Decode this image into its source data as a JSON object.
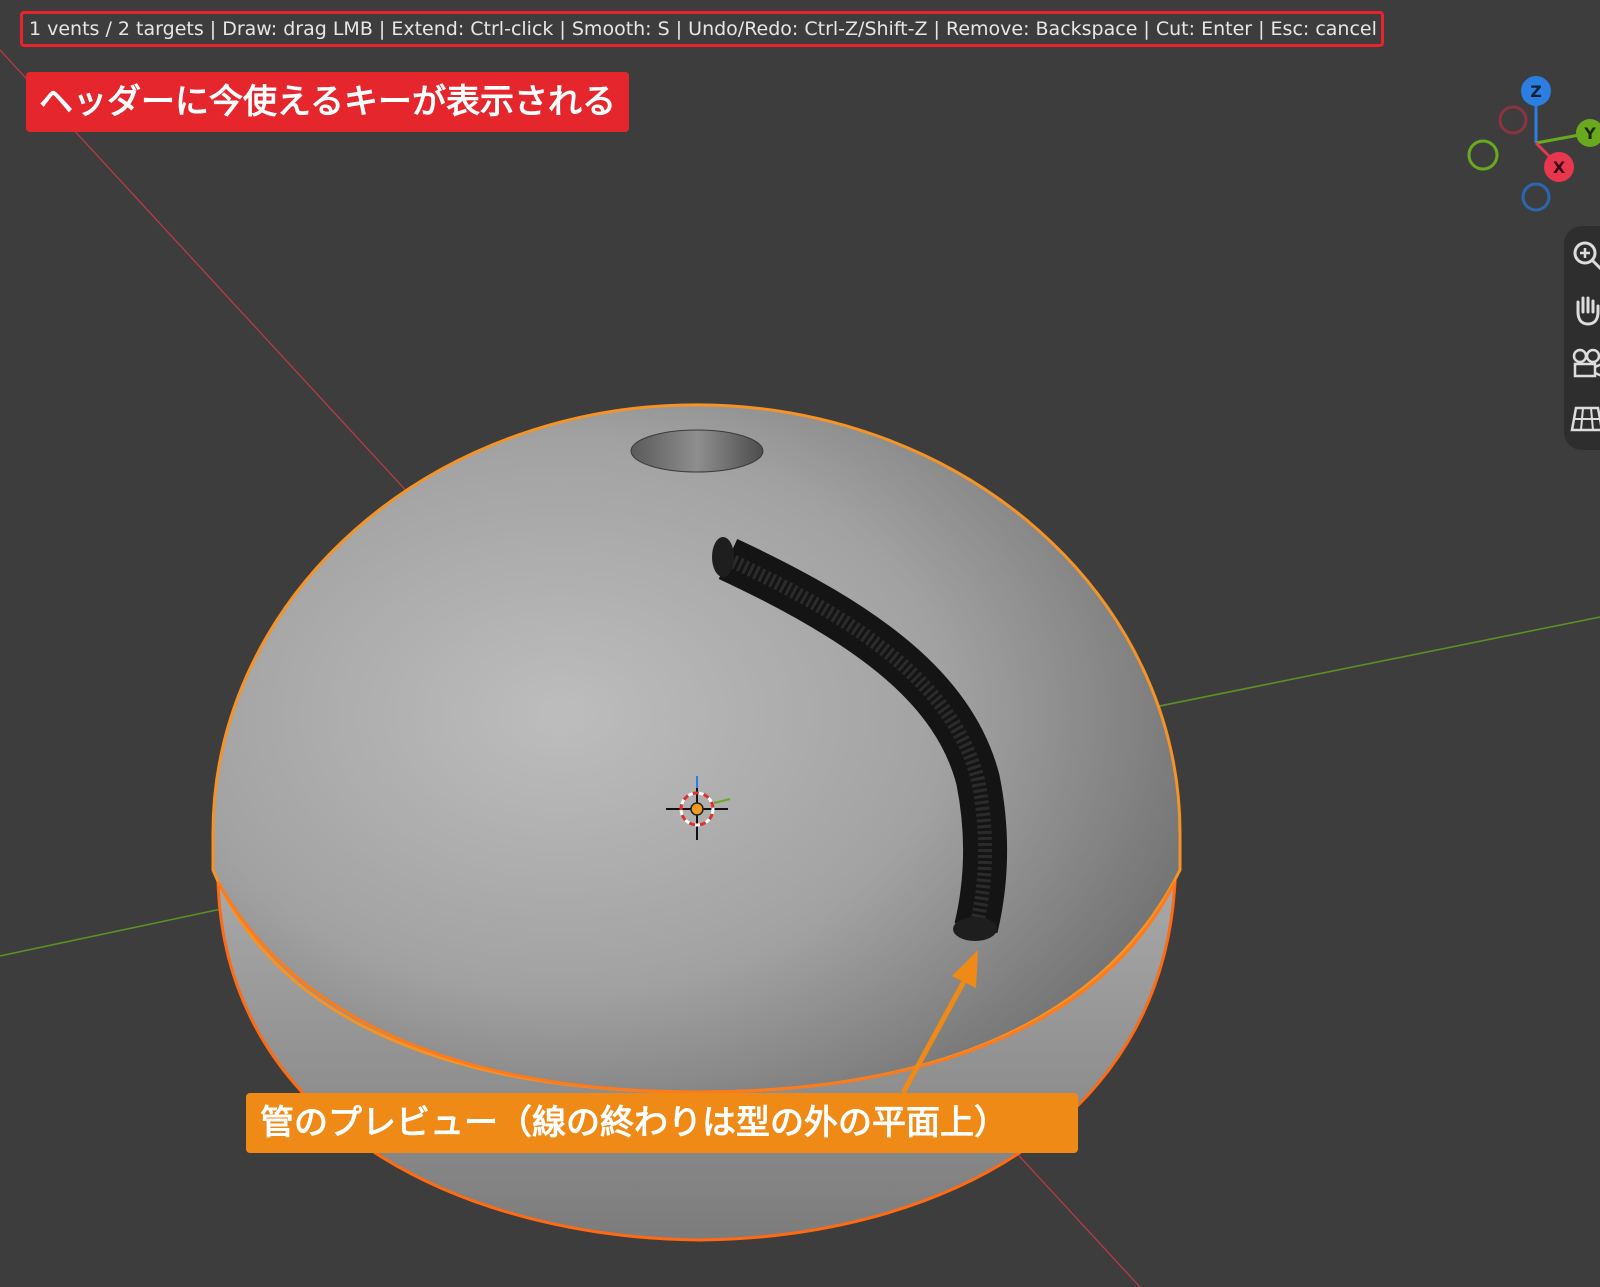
{
  "header": {
    "status_text": "1 vents / 2 targets | Draw: drag LMB | Extend: Ctrl-click | Smooth: S | Undo/Redo: Ctrl-Z/Shift-Z | Remove: Backspace | Cut: Enter | Esc: cancel"
  },
  "callouts": {
    "header_note": "ヘッダーに今使えるキーが表示される",
    "tube_note": "管のプレビュー（線の終わりは型の外の平面上）"
  },
  "gizmo": {
    "axis_z": "Z",
    "axis_y": "Y",
    "axis_x": "X",
    "colors": {
      "x": "#e8364f",
      "y": "#6aa91f",
      "z": "#2c7fe0"
    }
  },
  "nav_tools": [
    {
      "icon": "zoom-in-icon"
    },
    {
      "icon": "hand-pan-icon"
    },
    {
      "icon": "camera-icon"
    },
    {
      "icon": "grid-ortho-icon"
    }
  ],
  "colors": {
    "viewport_bg": "#3d3d3d",
    "selection_outline": "#f07f1a",
    "header_highlight": "#e8232b",
    "callout_red": "#e5262d",
    "callout_orange": "#ef8a17"
  }
}
